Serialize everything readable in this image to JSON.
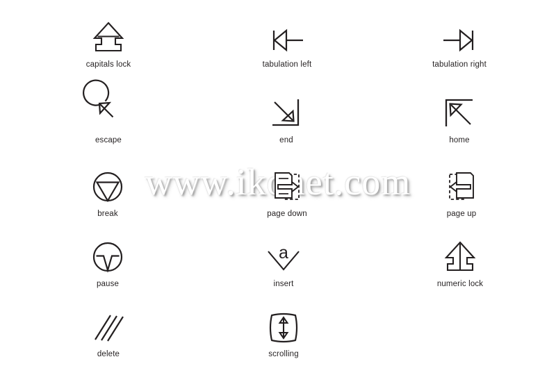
{
  "watermark": {
    "text": "www.ikonet.com"
  },
  "page": {
    "title": "keyboard key symbols",
    "background_color": "#ffffff",
    "stroke_color": "#231f20",
    "label_color": "#231f20"
  },
  "icons": [
    {
      "id": "capitals-lock",
      "label": "capitals lock",
      "icon_name": "capitals-lock-icon",
      "row": 1,
      "col": 1
    },
    {
      "id": "tabulation-left",
      "label": "tabulation left",
      "icon_name": "tabulation-left-icon",
      "row": 1,
      "col": 2
    },
    {
      "id": "tabulation-right",
      "label": "tabulation right",
      "icon_name": "tabulation-right-icon",
      "row": 1,
      "col": 3
    },
    {
      "id": "escape",
      "label": "escape",
      "icon_name": "escape-icon",
      "row": 2,
      "col": 1
    },
    {
      "id": "end",
      "label": "end",
      "icon_name": "end-icon",
      "row": 2,
      "col": 2
    },
    {
      "id": "home",
      "label": "home",
      "icon_name": "home-icon",
      "row": 2,
      "col": 3
    },
    {
      "id": "break",
      "label": "break",
      "icon_name": "break-icon",
      "row": 3,
      "col": 1
    },
    {
      "id": "page-down",
      "label": "page down",
      "icon_name": "page-down-icon",
      "row": 3,
      "col": 2
    },
    {
      "id": "page-up",
      "label": "page up",
      "icon_name": "page-up-icon",
      "row": 3,
      "col": 3
    },
    {
      "id": "pause",
      "label": "pause",
      "icon_name": "pause-icon",
      "row": 4,
      "col": 1
    },
    {
      "id": "insert",
      "label": "insert",
      "icon_name": "insert-icon",
      "row": 4,
      "col": 2
    },
    {
      "id": "numeric-lock",
      "label": "numeric lock",
      "icon_name": "numeric-lock-icon",
      "row": 4,
      "col": 3
    },
    {
      "id": "delete",
      "label": "delete",
      "icon_name": "delete-icon",
      "row": 5,
      "col": 1
    },
    {
      "id": "scrolling",
      "label": "scrolling",
      "icon_name": "scrolling-icon",
      "row": 5,
      "col": 2
    }
  ],
  "insert_glyph_letter": "a"
}
